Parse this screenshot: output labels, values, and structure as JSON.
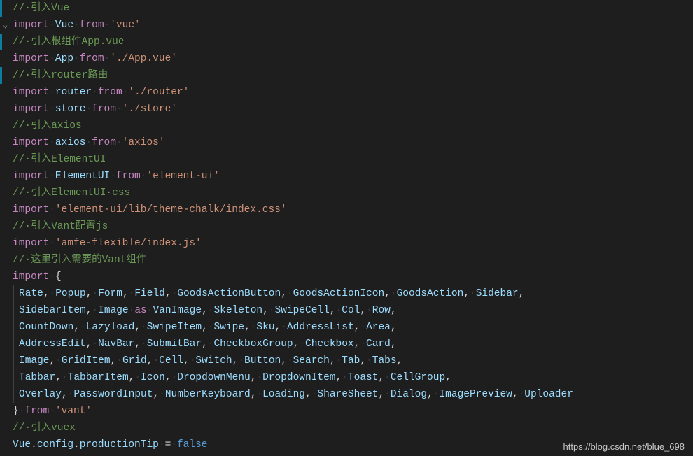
{
  "watermark": "https://blog.csdn.net/blue_698",
  "lines": [
    {
      "mod": true,
      "fold": "",
      "tokens": [
        {
          "t": "//·引入Vue",
          "c": "c-green"
        }
      ]
    },
    {
      "mod": false,
      "fold": "v",
      "tokens": [
        {
          "t": "import",
          "c": "c-purple"
        },
        {
          "t": "·",
          "c": "ws"
        },
        {
          "t": "Vue",
          "c": "c-blue"
        },
        {
          "t": "·",
          "c": "ws"
        },
        {
          "t": "from",
          "c": "c-purple"
        },
        {
          "t": "·",
          "c": "ws"
        },
        {
          "t": "'vue'",
          "c": "c-orange"
        }
      ]
    },
    {
      "mod": true,
      "fold": "",
      "tokens": [
        {
          "t": "//·引入根组件App.vue",
          "c": "c-green"
        }
      ]
    },
    {
      "mod": false,
      "fold": "",
      "tokens": [
        {
          "t": "import",
          "c": "c-purple"
        },
        {
          "t": "·",
          "c": "ws"
        },
        {
          "t": "App",
          "c": "c-blue"
        },
        {
          "t": "·",
          "c": "ws"
        },
        {
          "t": "from",
          "c": "c-purple"
        },
        {
          "t": "·",
          "c": "ws"
        },
        {
          "t": "'./App.vue'",
          "c": "c-orange"
        }
      ]
    },
    {
      "mod": true,
      "fold": "",
      "tokens": [
        {
          "t": "//·引入router路由",
          "c": "c-green"
        }
      ]
    },
    {
      "mod": false,
      "fold": "",
      "tokens": [
        {
          "t": "import",
          "c": "c-purple"
        },
        {
          "t": "·",
          "c": "ws"
        },
        {
          "t": "router",
          "c": "c-blue"
        },
        {
          "t": "·",
          "c": "ws"
        },
        {
          "t": "from",
          "c": "c-purple"
        },
        {
          "t": "·",
          "c": "ws"
        },
        {
          "t": "'./router'",
          "c": "c-orange"
        }
      ]
    },
    {
      "mod": false,
      "fold": "",
      "tokens": [
        {
          "t": "import",
          "c": "c-purple"
        },
        {
          "t": "·",
          "c": "ws"
        },
        {
          "t": "store",
          "c": "c-blue"
        },
        {
          "t": "·",
          "c": "ws"
        },
        {
          "t": "from",
          "c": "c-purple"
        },
        {
          "t": "·",
          "c": "ws"
        },
        {
          "t": "'./store'",
          "c": "c-orange"
        }
      ]
    },
    {
      "mod": false,
      "fold": "",
      "tokens": [
        {
          "t": "//·引入axios",
          "c": "c-green"
        }
      ]
    },
    {
      "mod": false,
      "fold": "",
      "tokens": [
        {
          "t": "import",
          "c": "c-purple"
        },
        {
          "t": "·",
          "c": "ws"
        },
        {
          "t": "axios",
          "c": "c-blue"
        },
        {
          "t": "·",
          "c": "ws"
        },
        {
          "t": "from",
          "c": "c-purple"
        },
        {
          "t": "·",
          "c": "ws"
        },
        {
          "t": "'axios'",
          "c": "c-orange"
        }
      ]
    },
    {
      "mod": false,
      "fold": "",
      "tokens": [
        {
          "t": "//·引入ElementUI",
          "c": "c-green"
        }
      ]
    },
    {
      "mod": false,
      "fold": "",
      "tokens": [
        {
          "t": "import",
          "c": "c-purple"
        },
        {
          "t": "·",
          "c": "ws"
        },
        {
          "t": "ElementUI",
          "c": "c-blue"
        },
        {
          "t": "·",
          "c": "ws"
        },
        {
          "t": "from",
          "c": "c-purple"
        },
        {
          "t": "·",
          "c": "ws"
        },
        {
          "t": "'element-ui'",
          "c": "c-orange"
        }
      ]
    },
    {
      "mod": false,
      "fold": "",
      "tokens": [
        {
          "t": "//·引入ElementUI·css",
          "c": "c-green"
        }
      ]
    },
    {
      "mod": false,
      "fold": "",
      "tokens": [
        {
          "t": "import",
          "c": "c-purple"
        },
        {
          "t": "·",
          "c": "ws"
        },
        {
          "t": "'element-ui/lib/theme-chalk/index.css'",
          "c": "c-orange"
        }
      ]
    },
    {
      "mod": false,
      "fold": "",
      "tokens": [
        {
          "t": "//·引入Vant配置js",
          "c": "c-green"
        }
      ]
    },
    {
      "mod": false,
      "fold": "",
      "tokens": [
        {
          "t": "import",
          "c": "c-purple"
        },
        {
          "t": "·",
          "c": "ws"
        },
        {
          "t": "'amfe-flexible/index.js'",
          "c": "c-orange"
        }
      ]
    },
    {
      "mod": false,
      "fold": "",
      "tokens": [
        {
          "t": "//·这里引入需要的Vant组件",
          "c": "c-green"
        }
      ]
    },
    {
      "mod": false,
      "fold": "",
      "tokens": [
        {
          "t": "import",
          "c": "c-purple"
        },
        {
          "t": "·",
          "c": "ws"
        },
        {
          "t": "{",
          "c": "c-white"
        }
      ]
    },
    {
      "mod": false,
      "fold": "",
      "indent": true,
      "tokens": [
        {
          "t": "Rate",
          "c": "c-blue"
        },
        {
          "t": ",·",
          "c": "c-white"
        },
        {
          "t": "Popup",
          "c": "c-blue"
        },
        {
          "t": ",·",
          "c": "c-white"
        },
        {
          "t": "Form",
          "c": "c-blue"
        },
        {
          "t": ",·",
          "c": "c-white"
        },
        {
          "t": "Field",
          "c": "c-blue"
        },
        {
          "t": ",·",
          "c": "c-white"
        },
        {
          "t": "GoodsActionButton",
          "c": "c-blue"
        },
        {
          "t": ",·",
          "c": "c-white"
        },
        {
          "t": "GoodsActionIcon",
          "c": "c-blue"
        },
        {
          "t": ",·",
          "c": "c-white"
        },
        {
          "t": "GoodsAction",
          "c": "c-blue"
        },
        {
          "t": ",·",
          "c": "c-white"
        },
        {
          "t": "Sidebar",
          "c": "c-blue"
        },
        {
          "t": ",",
          "c": "c-white"
        }
      ]
    },
    {
      "mod": false,
      "fold": "",
      "indent": true,
      "tokens": [
        {
          "t": "SidebarItem",
          "c": "c-blue"
        },
        {
          "t": ",·",
          "c": "c-white"
        },
        {
          "t": "Image",
          "c": "c-blue"
        },
        {
          "t": "·",
          "c": "ws"
        },
        {
          "t": "as",
          "c": "c-purple"
        },
        {
          "t": "·",
          "c": "ws"
        },
        {
          "t": "VanImage",
          "c": "c-blue"
        },
        {
          "t": ",·",
          "c": "c-white"
        },
        {
          "t": "Skeleton",
          "c": "c-blue"
        },
        {
          "t": ",·",
          "c": "c-white"
        },
        {
          "t": "SwipeCell",
          "c": "c-blue"
        },
        {
          "t": ",·",
          "c": "c-white"
        },
        {
          "t": "Col",
          "c": "c-blue"
        },
        {
          "t": ",·",
          "c": "c-white"
        },
        {
          "t": "Row",
          "c": "c-blue"
        },
        {
          "t": ",",
          "c": "c-white"
        }
      ]
    },
    {
      "mod": false,
      "fold": "",
      "indent": true,
      "tokens": [
        {
          "t": "CountDown",
          "c": "c-blue"
        },
        {
          "t": ",·",
          "c": "c-white"
        },
        {
          "t": "Lazyload",
          "c": "c-blue"
        },
        {
          "t": ",·",
          "c": "c-white"
        },
        {
          "t": "SwipeItem",
          "c": "c-blue"
        },
        {
          "t": ",·",
          "c": "c-white"
        },
        {
          "t": "Swipe",
          "c": "c-blue"
        },
        {
          "t": ",·",
          "c": "c-white"
        },
        {
          "t": "Sku",
          "c": "c-blue"
        },
        {
          "t": ",·",
          "c": "c-white"
        },
        {
          "t": "AddressList",
          "c": "c-blue"
        },
        {
          "t": ",·",
          "c": "c-white"
        },
        {
          "t": "Area",
          "c": "c-blue"
        },
        {
          "t": ",",
          "c": "c-white"
        }
      ]
    },
    {
      "mod": false,
      "fold": "",
      "indent": true,
      "tokens": [
        {
          "t": "AddressEdit",
          "c": "c-blue"
        },
        {
          "t": ",·",
          "c": "c-white"
        },
        {
          "t": "NavBar",
          "c": "c-blue"
        },
        {
          "t": ",·",
          "c": "c-white"
        },
        {
          "t": "SubmitBar",
          "c": "c-blue"
        },
        {
          "t": ",·",
          "c": "c-white"
        },
        {
          "t": "CheckboxGroup",
          "c": "c-blue"
        },
        {
          "t": ",·",
          "c": "c-white"
        },
        {
          "t": "Checkbox",
          "c": "c-blue"
        },
        {
          "t": ",·",
          "c": "c-white"
        },
        {
          "t": "Card",
          "c": "c-blue"
        },
        {
          "t": ",",
          "c": "c-white"
        }
      ]
    },
    {
      "mod": false,
      "fold": "",
      "indent": true,
      "tokens": [
        {
          "t": "Image",
          "c": "c-blue"
        },
        {
          "t": ",·",
          "c": "c-white"
        },
        {
          "t": "GridItem",
          "c": "c-blue"
        },
        {
          "t": ",·",
          "c": "c-white"
        },
        {
          "t": "Grid",
          "c": "c-blue"
        },
        {
          "t": ",·",
          "c": "c-white"
        },
        {
          "t": "Cell",
          "c": "c-blue"
        },
        {
          "t": ",·",
          "c": "c-white"
        },
        {
          "t": "Switch",
          "c": "c-blue"
        },
        {
          "t": ",·",
          "c": "c-white"
        },
        {
          "t": "Button",
          "c": "c-blue"
        },
        {
          "t": ",·",
          "c": "c-white"
        },
        {
          "t": "Search",
          "c": "c-blue"
        },
        {
          "t": ",·",
          "c": "c-white"
        },
        {
          "t": "Tab",
          "c": "c-blue"
        },
        {
          "t": ",·",
          "c": "c-white"
        },
        {
          "t": "Tabs",
          "c": "c-blue"
        },
        {
          "t": ",",
          "c": "c-white"
        }
      ]
    },
    {
      "mod": false,
      "fold": "",
      "indent": true,
      "tokens": [
        {
          "t": "Tabbar",
          "c": "c-blue"
        },
        {
          "t": ",·",
          "c": "c-white"
        },
        {
          "t": "TabbarItem",
          "c": "c-blue"
        },
        {
          "t": ",·",
          "c": "c-white"
        },
        {
          "t": "Icon",
          "c": "c-blue"
        },
        {
          "t": ",·",
          "c": "c-white"
        },
        {
          "t": "DropdownMenu",
          "c": "c-blue"
        },
        {
          "t": ",·",
          "c": "c-white"
        },
        {
          "t": "DropdownItem",
          "c": "c-blue"
        },
        {
          "t": ",·",
          "c": "c-white"
        },
        {
          "t": "Toast",
          "c": "c-blue"
        },
        {
          "t": ",·",
          "c": "c-white"
        },
        {
          "t": "CellGroup",
          "c": "c-blue"
        },
        {
          "t": ",",
          "c": "c-white"
        }
      ]
    },
    {
      "mod": false,
      "fold": "",
      "indent": true,
      "tokens": [
        {
          "t": "Overlay",
          "c": "c-blue"
        },
        {
          "t": ",·",
          "c": "c-white"
        },
        {
          "t": "PasswordInput",
          "c": "c-blue"
        },
        {
          "t": ",·",
          "c": "c-white"
        },
        {
          "t": "NumberKeyboard",
          "c": "c-blue"
        },
        {
          "t": ",·",
          "c": "c-white"
        },
        {
          "t": "Loading",
          "c": "c-blue"
        },
        {
          "t": ",·",
          "c": "c-white"
        },
        {
          "t": "ShareSheet",
          "c": "c-blue"
        },
        {
          "t": ",·",
          "c": "c-white"
        },
        {
          "t": "Dialog",
          "c": "c-blue"
        },
        {
          "t": ",·",
          "c": "c-white"
        },
        {
          "t": "ImagePreview",
          "c": "c-blue"
        },
        {
          "t": ",·",
          "c": "c-white"
        },
        {
          "t": "Uploader",
          "c": "c-blue"
        }
      ]
    },
    {
      "mod": false,
      "fold": "",
      "tokens": [
        {
          "t": "}",
          "c": "c-white"
        },
        {
          "t": "·",
          "c": "ws"
        },
        {
          "t": "from",
          "c": "c-purple"
        },
        {
          "t": "·",
          "c": "ws"
        },
        {
          "t": "'vant'",
          "c": "c-orange"
        }
      ]
    },
    {
      "mod": false,
      "fold": "",
      "tokens": [
        {
          "t": "//·引入vuex",
          "c": "c-green"
        }
      ]
    },
    {
      "mod": false,
      "fold": "",
      "tokens": [
        {
          "t": "Vue",
          "c": "c-blue"
        },
        {
          "t": ".",
          "c": "c-white"
        },
        {
          "t": "config",
          "c": "c-blue"
        },
        {
          "t": ".",
          "c": "c-white"
        },
        {
          "t": "productionTip",
          "c": "c-blue"
        },
        {
          "t": "·",
          "c": "ws"
        },
        {
          "t": "=",
          "c": "c-white"
        },
        {
          "t": "·",
          "c": "ws"
        },
        {
          "t": "false",
          "c": "c-darkblue"
        }
      ]
    }
  ]
}
